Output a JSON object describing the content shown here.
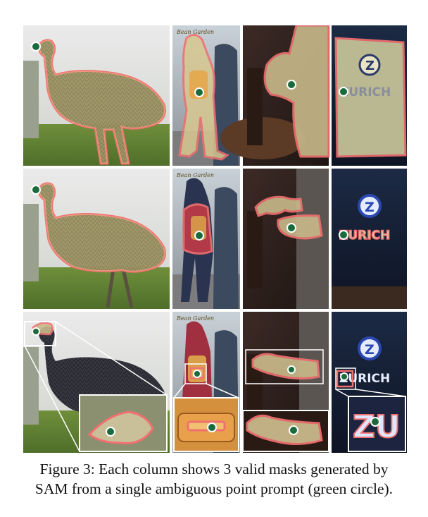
{
  "figure": {
    "columns": [
      "emu",
      "person-backpack",
      "arm-bottle",
      "zurich-sign"
    ],
    "rows": 3,
    "point_color": "#1a6b3c",
    "mask_outline_color": "#f07070",
    "mask_fill_color": "#e8d890",
    "panel_text": {
      "bean_garden_logo": "Bean Garden",
      "sign_z": "Z",
      "sign_zurich": "ZURICH",
      "sign_zurich_zoom": "ZU"
    }
  },
  "caption": {
    "line1": "Figure 3: Each column shows 3 valid masks generated by",
    "line2": "SAM from a single ambiguous point prompt (green circle)."
  }
}
